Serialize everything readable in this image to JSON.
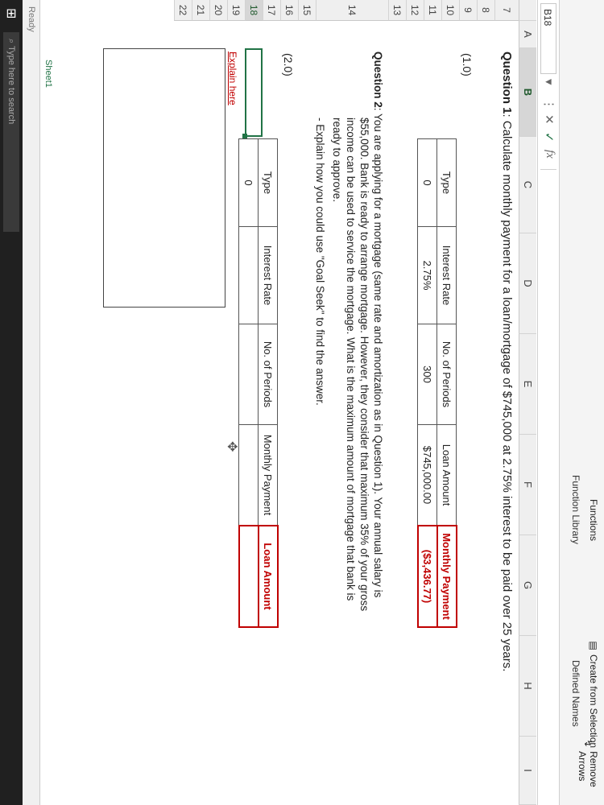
{
  "ribbon": {
    "functions_label": "Functions",
    "function_library": "Function Library",
    "create_from_selection": "Create from Selection",
    "defined_names": "Defined Names",
    "remove_arrows": "Remove Arrows"
  },
  "formula_bar": {
    "name_box": "B18",
    "fx": "fx",
    "value": ""
  },
  "columns": [
    "A",
    "B",
    "C",
    "D",
    "E",
    "F",
    "G",
    "H",
    "I"
  ],
  "rows": [
    "7",
    "8",
    "9",
    "10",
    "11",
    "12",
    "13",
    "14",
    "15",
    "16",
    "17",
    "18",
    "19",
    "20",
    "21",
    "22"
  ],
  "question1": {
    "label": "Question 1",
    "text": ": Calculate monthly payment for a loan/mortgage of $745,000 at 2.75% interest to be paid over 25 years.",
    "mark": "(1.0)",
    "headers": [
      "Type",
      "Interest Rate",
      "No. of Periods",
      "Loan Amount",
      "Monthly Payment"
    ],
    "values": [
      "0",
      "2.75%",
      "300",
      "$745,000.00",
      "($3,436.77)"
    ]
  },
  "question2": {
    "label": "Question 2",
    "line1": ": You are applying for a mortgage (same rate and amortization as in Question 1). Your annual salary is",
    "line2": "$55,000. Bank is ready to arrange mortgage. However, they consider that maximum 35% of your gross",
    "line3": "income can be used to service the mortgage. What is the maximum amount of mortgage that bank is",
    "line4": "ready to approve.",
    "line5": "- Explain how you could use \"Goal Seek\" to find the answer.",
    "mark": "(2.0)",
    "headers": [
      "Type",
      "Interest Rate",
      "No. of Periods",
      "Monthly Payment",
      "Loan Amount"
    ],
    "values": [
      "0",
      "",
      "",
      "",
      ""
    ]
  },
  "explain_label": "Explain here",
  "sheet_tab": "Sheet1",
  "status": "Ready",
  "taskbar_search": "Type here to search",
  "colors": {
    "accent": "#217346",
    "red": "#c00000"
  }
}
